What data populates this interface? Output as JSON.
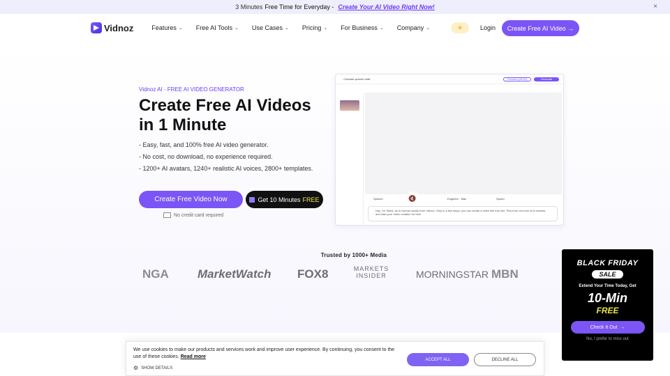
{
  "topbar": {
    "prefix": "3 Minutes",
    "highlight": "Free Time for Everyday -",
    "link": "Create Your AI Video Right Now!",
    "close": "×"
  },
  "nav": {
    "brand": "Vidnoz",
    "items": [
      "Features",
      "Free AI Tools",
      "Use Cases",
      "Pricing",
      "For Business",
      "Company"
    ],
    "login": "Login",
    "cta": "Create Free AI Video",
    "cta_icon": "→"
  },
  "hero": {
    "eyebrow": "Vidnoz AI - FREE AI VIDEO GENERATOR",
    "title": "Create Free AI Videos in 1 Minute",
    "bullets": [
      "- Easy, fast, and 100% free AI video generator.",
      "- No cost, no download, no experience required.",
      "- 1200+ AI avatars, 1240+ realistic AI voices, 2800+ templates."
    ],
    "primary": "Create Free Video Now",
    "secondary": "Get 10 Minutes",
    "secondary_free": "FREE",
    "no_card": "No credit card required"
  },
  "editor": {
    "title": "Damian speech draft",
    "preview": "Preview (00:00)",
    "generate": "Generate",
    "script": "Hey, I'm Stella, an AI human avatar from Vidnoz. Only in a few steps, you can create a video like this one. Pick from our tons of AI avatars, and start your video creation for free!",
    "speech": "Speech",
    "voice": "Engineer - Man",
    "speed": "Speed"
  },
  "media": {
    "heading": "Trusted by 1000+ Media",
    "logos": [
      "NGA",
      "MarketWatch",
      "FOX8",
      "MARKETS INSIDER",
      "MORNINGSTAR",
      "MBN"
    ]
  },
  "promo": {
    "line1": "BLACK FRIDAY",
    "sale": "SALE",
    "extend": "Extend Your Time Today, Get",
    "minutes": "10-Min",
    "free": "FREE",
    "cta": "Check It Out",
    "dismiss": "No, I prefer to miss out"
  },
  "cookie": {
    "text": "We use cookies to make our products and services work and improve user experience. By continuing, you consent to the use of these cookies.",
    "link": "Read more",
    "details": "SHOW DETAILS",
    "accept": "ACCEPT ALL",
    "decline": "DECLINE ALL"
  },
  "colors": {
    "brand": "#7b55f5",
    "promo_bg": "#000000",
    "free_yellow": "#ebe34b"
  }
}
